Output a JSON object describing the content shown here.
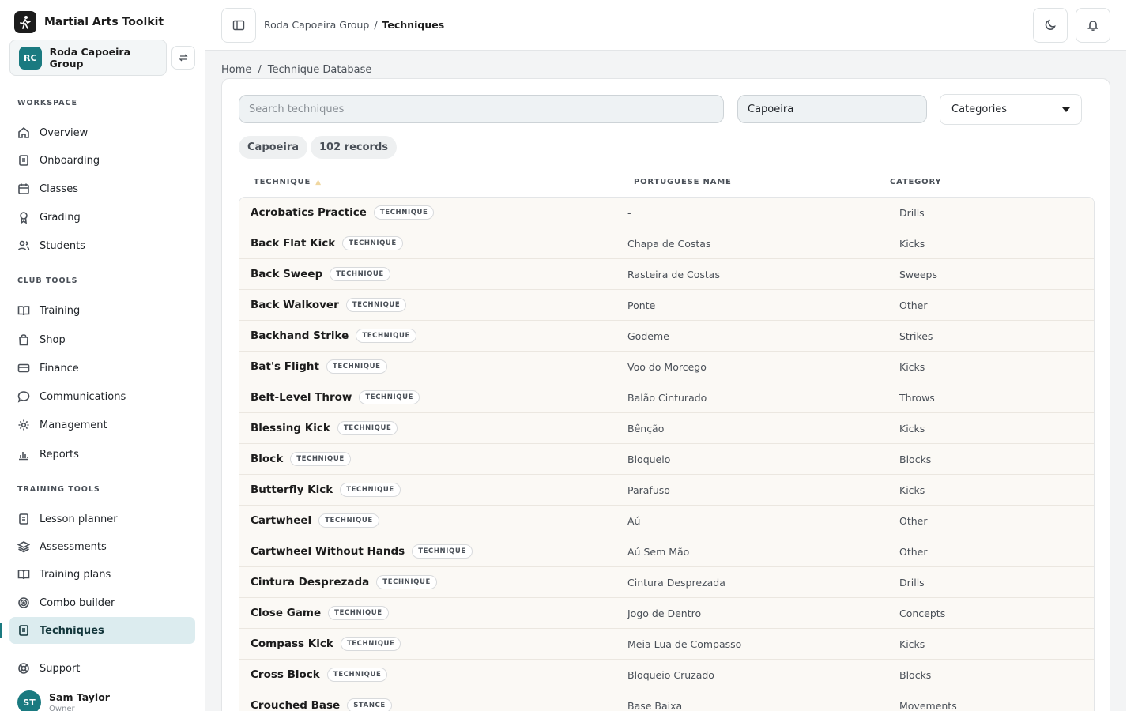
{
  "app": {
    "name": "Martial Arts Toolkit",
    "logo_icon": "martial-artist-icon"
  },
  "club": {
    "initials": "RC",
    "name": "Roda Capoeira Group"
  },
  "sidebar": {
    "workspace_label": "WORKSPACE",
    "club_tools_label": "CLUB TOOLS",
    "training_tools_label": "TRAINING TOOLS",
    "workspace": [
      {
        "label": "Overview",
        "icon": "home-icon"
      },
      {
        "label": "Onboarding",
        "icon": "clipboard-icon"
      },
      {
        "label": "Classes",
        "icon": "calendar-icon"
      },
      {
        "label": "Grading",
        "icon": "award-icon"
      },
      {
        "label": "Students",
        "icon": "users-icon"
      }
    ],
    "club_tools": [
      {
        "label": "Training",
        "icon": "book-icon"
      },
      {
        "label": "Shop",
        "icon": "shopping-bag-icon"
      },
      {
        "label": "Finance",
        "icon": "credit-card-icon"
      },
      {
        "label": "Communications",
        "icon": "message-icon"
      },
      {
        "label": "Management",
        "icon": "gear-icon"
      },
      {
        "label": "Reports",
        "icon": "bar-chart-icon"
      }
    ],
    "training_tools": [
      {
        "label": "Lesson planner",
        "icon": "clipboard-icon"
      },
      {
        "label": "Assessments",
        "icon": "layers-icon"
      },
      {
        "label": "Training plans",
        "icon": "book-icon"
      },
      {
        "label": "Combo builder",
        "icon": "target-icon"
      },
      {
        "label": "Techniques",
        "icon": "clipboard-icon",
        "active": true
      }
    ],
    "support_label": "Support",
    "user": {
      "initials": "ST",
      "name": "Sam Taylor",
      "role": "Owner"
    }
  },
  "topbar": {
    "breadcrumb_parent": "Roda Capoeira Group",
    "breadcrumb_sep": "/",
    "breadcrumb_current": "Techniques"
  },
  "page": {
    "crumb_home": "Home",
    "crumb_sep": "/",
    "crumb_current": "Technique Database"
  },
  "filters": {
    "search_placeholder": "Search techniques",
    "style_value": "Capoeira",
    "categories_label": "Categories",
    "chips": [
      "Capoeira",
      "102 records"
    ]
  },
  "table": {
    "columns": [
      "TECHNIQUE",
      "PORTUGUESE NAME",
      "CATEGORY"
    ],
    "rows": [
      {
        "name": "Acrobatics Practice",
        "type": "TECHNIQUE",
        "pt": "-",
        "category": "Drills"
      },
      {
        "name": "Back Flat Kick",
        "type": "TECHNIQUE",
        "pt": "Chapa de Costas",
        "category": "Kicks"
      },
      {
        "name": "Back Sweep",
        "type": "TECHNIQUE",
        "pt": "Rasteira de Costas",
        "category": "Sweeps"
      },
      {
        "name": "Back Walkover",
        "type": "TECHNIQUE",
        "pt": "Ponte",
        "category": "Other"
      },
      {
        "name": "Backhand Strike",
        "type": "TECHNIQUE",
        "pt": "Godeme",
        "category": "Strikes"
      },
      {
        "name": "Bat's Flight",
        "type": "TECHNIQUE",
        "pt": "Voo do Morcego",
        "category": "Kicks"
      },
      {
        "name": "Belt-Level Throw",
        "type": "TECHNIQUE",
        "pt": "Balão Cinturado",
        "category": "Throws"
      },
      {
        "name": "Blessing Kick",
        "type": "TECHNIQUE",
        "pt": "Bênção",
        "category": "Kicks"
      },
      {
        "name": "Block",
        "type": "TECHNIQUE",
        "pt": "Bloqueio",
        "category": "Blocks"
      },
      {
        "name": "Butterfly Kick",
        "type": "TECHNIQUE",
        "pt": "Parafuso",
        "category": "Kicks"
      },
      {
        "name": "Cartwheel",
        "type": "TECHNIQUE",
        "pt": "Aú",
        "category": "Other"
      },
      {
        "name": "Cartwheel Without Hands",
        "type": "TECHNIQUE",
        "pt": "Aú Sem Mão",
        "category": "Other"
      },
      {
        "name": "Cintura Desprezada",
        "type": "TECHNIQUE",
        "pt": "Cintura Desprezada",
        "category": "Drills"
      },
      {
        "name": "Close Game",
        "type": "TECHNIQUE",
        "pt": "Jogo de Dentro",
        "category": "Concepts"
      },
      {
        "name": "Compass Kick",
        "type": "TECHNIQUE",
        "pt": "Meia Lua de Compasso",
        "category": "Kicks"
      },
      {
        "name": "Cross Block",
        "type": "TECHNIQUE",
        "pt": "Bloqueio Cruzado",
        "category": "Blocks"
      },
      {
        "name": "Crouched Base",
        "type": "STANCE",
        "pt": "Base Baixa",
        "category": "Movements"
      }
    ]
  }
}
